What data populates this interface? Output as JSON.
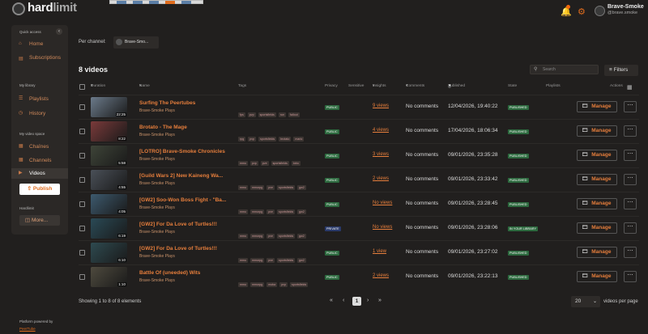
{
  "header": {
    "logo_hard": "hard",
    "logo_limit": "limit",
    "user_name": "Brave-Smoke",
    "user_handle": "@brave.smoke"
  },
  "sidebar": {
    "quick_access": "Quick access",
    "home": "Home",
    "subscriptions": "Subscriptions",
    "my_library": "My library",
    "playlists": "Playlists",
    "history": "History",
    "video_space": "My video space",
    "channels_label": "Chaînes",
    "channels": "Channels",
    "videos": "Videos",
    "publish": "Publish",
    "hardlimit": "Hardlimit",
    "more": "More...",
    "powered": "Platform powered by",
    "peertube": "PeerTube"
  },
  "filter": {
    "per_channel": "Per channel:",
    "channel_name": "Brave-Smo...",
    "count": "8 videos",
    "search_placeholder": "Search",
    "filters": "Filters"
  },
  "columns": {
    "duration": "Duration",
    "name": "Name",
    "tags": "Tags",
    "privacy": "Privacy",
    "sensitive": "Sensitive",
    "insights": "Insights",
    "comments": "Comments",
    "published": "Published",
    "state": "State",
    "playlists": "Playlists",
    "actions": "Actions"
  },
  "rows": [
    {
      "name": "Surfing The Peertubes",
      "channel": "Brave-Smoke Plays",
      "duration": "22:25",
      "tags": [
        "fps",
        "pvp",
        "sportsfields",
        "run",
        "fallout"
      ],
      "privacy": "PUBLIC",
      "insights": "9 views",
      "comments": "No comments",
      "published": "12/04/2026, 19:40:22",
      "state": "PUBLISHED",
      "manage": "Manage",
      "privacy_color": "#2d6a3f",
      "thumb_color": "#6b7a8a"
    },
    {
      "name": "Brotato - The Mage",
      "channel": "Brave-Smoke Plays",
      "duration": "8:22",
      "tags": [
        "rpg",
        "pvp",
        "sportsfields",
        "brotato",
        "mario"
      ],
      "privacy": "PUBLIC",
      "insights": "4 views",
      "comments": "No comments",
      "published": "17/04/2026, 18:06:34",
      "state": "PUBLISHED",
      "manage": "Manage",
      "privacy_color": "#2d6a3f",
      "thumb_color": "#7a3a3a"
    },
    {
      "name": "[LOTRO] Brave-Smoke Chronicles",
      "channel": "Brave-Smoke Plays",
      "duration": "5:58",
      "tags": [
        "mmo",
        "pvp",
        "pve",
        "sportsfields",
        "lotro"
      ],
      "privacy": "PUBLIC",
      "insights": "3 views",
      "comments": "No comments",
      "published": "09/01/2026, 23:35:28",
      "state": "PUBLISHED",
      "manage": "Manage",
      "privacy_color": "#2d6a3f",
      "thumb_color": "#3e4438"
    },
    {
      "name": "[Guild Wars 2] New Kaineng Wa...",
      "channel": "Brave-Smoke Plays",
      "duration": "4:55",
      "tags": [
        "mmo",
        "mmorpg",
        "pve",
        "sportsfields",
        "gw2"
      ],
      "privacy": "PUBLIC",
      "insights": "2 views",
      "comments": "No comments",
      "published": "09/01/2026, 23:33:42",
      "state": "PUBLISHED",
      "manage": "Manage",
      "privacy_color": "#2d6a3f",
      "thumb_color": "#4a5058"
    },
    {
      "name": "[GW2] Soo-Won Boss Fight - \"Ba...",
      "channel": "Brave-Smoke Plays",
      "duration": "4:05",
      "tags": [
        "mmo",
        "mmorpg",
        "pve",
        "sportsfields",
        "gw2"
      ],
      "privacy": "PUBLIC",
      "insights": "No views",
      "comments": "No comments",
      "published": "09/01/2026, 23:28:45",
      "state": "PUBLISHED",
      "manage": "Manage",
      "privacy_color": "#2d6a3f",
      "thumb_color": "#3d5a6e"
    },
    {
      "name": "[GW2] For Da Love of Turtles!!!",
      "channel": "Brave-Smoke Plays",
      "duration": "6:19",
      "tags": [
        "mmo",
        "mmorpg",
        "pve",
        "sportsfields",
        "gw2"
      ],
      "privacy": "PRIVATE",
      "insights": "No views",
      "comments": "No comments",
      "published": "09/01/2026, 23:28:06",
      "state": "IN YOUR LIBRARY",
      "manage": "Manage",
      "privacy_color": "#2a3a6a",
      "thumb_color": "#2a4a56"
    },
    {
      "name": "[GW2] For Da Love of Turtles!!!",
      "channel": "Brave-Smoke Plays",
      "duration": "6:10",
      "tags": [
        "mmo",
        "mmorpg",
        "pve",
        "sportsfields",
        "gw2"
      ],
      "privacy": "PUBLIC",
      "insights": "1 view",
      "comments": "No comments",
      "published": "09/01/2026, 23:27:02",
      "state": "PUBLISHED",
      "manage": "Manage",
      "privacy_color": "#2d6a3f",
      "thumb_color": "#2e4a50"
    },
    {
      "name": "Battle Of (uneeded) Wits",
      "channel": "Brave-Smoke Plays",
      "duration": "1:10",
      "tags": [
        "mmo",
        "mmorpg",
        "moba",
        "pvp",
        "sportsfields"
      ],
      "privacy": "PUBLIC",
      "insights": "2 views",
      "comments": "No comments",
      "published": "09/01/2026, 23:22:13",
      "state": "PUBLISHED",
      "manage": "Manage",
      "privacy_color": "#2d6a3f",
      "thumb_color": "#4e4a3e"
    }
  ],
  "footer": {
    "showing": "Showing 1 to 8 of 8 elements",
    "page": "1",
    "per_page": "20",
    "per_page_label": "videos per page"
  }
}
